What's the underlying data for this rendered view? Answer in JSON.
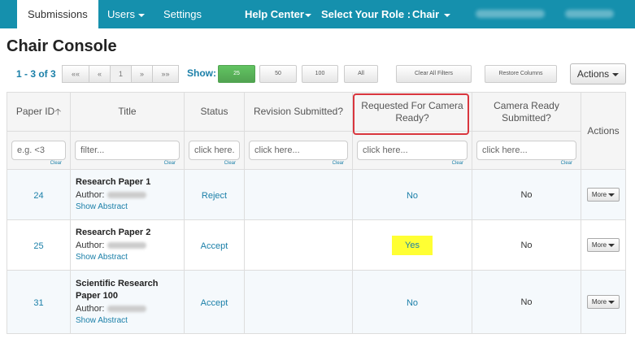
{
  "nav": {
    "submissions": "Submissions",
    "users": "Users",
    "settings": "Settings",
    "help_center": "Help Center",
    "select_role": "Select Your Role :",
    "role": "Chair"
  },
  "page_title": "Chair Console",
  "pager": {
    "count": "1 - 3 of 3",
    "first": "««",
    "prev": "«",
    "page": "1",
    "next": "»",
    "last": "»»"
  },
  "show": {
    "label": "Show:",
    "options": [
      "25",
      "50",
      "100",
      "All"
    ],
    "selected": "25"
  },
  "toolbar": {
    "clear_filters": "Clear All Filters",
    "restore_columns": "Restore Columns",
    "actions": "Actions"
  },
  "columns": {
    "paper_id": "Paper ID",
    "title": "Title",
    "status": "Status",
    "revision": "Revision Submitted?",
    "requested_camera": "Requested For Camera Ready?",
    "camera_submitted": "Camera Ready Submitted?",
    "actions": "Actions"
  },
  "filters": {
    "paper_id_placeholder": "e.g. <3",
    "title_placeholder": "filter...",
    "click_here": "click here...",
    "clear": "Clear"
  },
  "rows": [
    {
      "id": "24",
      "title": "Research Paper 1",
      "author_label": "Author:",
      "show_abstract": "Show Abstract",
      "status": "Reject",
      "revision": "",
      "requested": "No",
      "camera": "No",
      "more": "More"
    },
    {
      "id": "25",
      "title": "Research Paper 2",
      "author_label": "Author:",
      "show_abstract": "Show Abstract",
      "status": "Accept",
      "revision": "",
      "requested": "Yes",
      "camera": "No",
      "more": "More"
    },
    {
      "id": "31",
      "title": "Scientific Research Paper 100",
      "author_label": "Author:",
      "show_abstract": "Show Abstract",
      "status": "Accept",
      "revision": "",
      "requested": "No",
      "camera": "No",
      "more": "More"
    }
  ],
  "colors": {
    "nav_bg": "#1590ad",
    "link": "#1a7fa8",
    "highlight_yellow": "#ffff33",
    "annotation_red": "#d9363e",
    "show_selected_green": "#5bb75b"
  }
}
